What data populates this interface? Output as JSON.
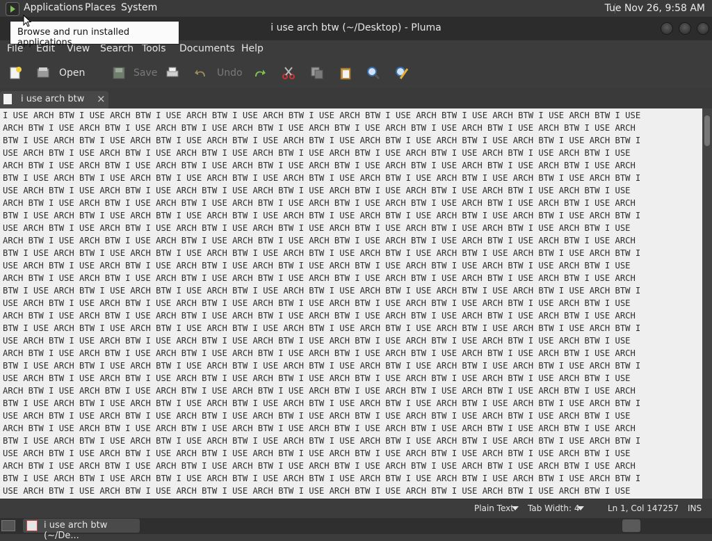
{
  "top_panel": {
    "menus": [
      "Applications",
      "Places",
      "System"
    ],
    "clock": "Tue Nov 26,  9:58 AM"
  },
  "tooltip": "Browse and run installed applications",
  "window": {
    "title": "i use arch btw (~/Desktop) - Pluma"
  },
  "menubar": [
    "File",
    "Edit",
    "View",
    "Search",
    "Tools",
    "Documents",
    "Help"
  ],
  "toolbar": {
    "open": "Open",
    "save": "Save",
    "undo": "Undo"
  },
  "tab": {
    "label": "i use arch btw",
    "close": "×"
  },
  "editor": {
    "lines": [
      "I USE ARCH BTW I USE ARCH BTW I USE ARCH BTW I USE ARCH BTW I USE ARCH BTW I USE ARCH BTW I USE ARCH BTW I USE ARCH BTW I USE",
      "ARCH BTW I USE ARCH BTW I USE ARCH BTW I USE ARCH BTW I USE ARCH BTW I USE ARCH BTW I USE ARCH BTW I USE ARCH BTW I USE ARCH",
      "BTW I USE ARCH BTW I USE ARCH BTW I USE ARCH BTW I USE ARCH BTW I USE ARCH BTW I USE ARCH BTW I USE ARCH BTW I USE ARCH BTW I",
      "USE ARCH BTW I USE ARCH BTW I USE ARCH BTW I USE ARCH BTW I USE ARCH BTW I USE ARCH BTW I USE ARCH BTW I USE ARCH BTW I USE",
      "ARCH BTW I USE ARCH BTW I USE ARCH BTW I USE ARCH BTW I USE ARCH BTW I USE ARCH BTW I USE ARCH BTW I USE ARCH BTW I USE ARCH",
      "BTW I USE ARCH BTW I USE ARCH BTW I USE ARCH BTW I USE ARCH BTW I USE ARCH BTW I USE ARCH BTW I USE ARCH BTW I USE ARCH BTW I",
      "USE ARCH BTW I USE ARCH BTW I USE ARCH BTW I USE ARCH BTW I USE ARCH BTW I USE ARCH BTW I USE ARCH BTW I USE ARCH BTW I USE",
      "ARCH BTW I USE ARCH BTW I USE ARCH BTW I USE ARCH BTW I USE ARCH BTW I USE ARCH BTW I USE ARCH BTW I USE ARCH BTW I USE ARCH",
      "BTW I USE ARCH BTW I USE ARCH BTW I USE ARCH BTW I USE ARCH BTW I USE ARCH BTW I USE ARCH BTW I USE ARCH BTW I USE ARCH BTW I",
      "USE ARCH BTW I USE ARCH BTW I USE ARCH BTW I USE ARCH BTW I USE ARCH BTW I USE ARCH BTW I USE ARCH BTW I USE ARCH BTW I USE",
      "ARCH BTW I USE ARCH BTW I USE ARCH BTW I USE ARCH BTW I USE ARCH BTW I USE ARCH BTW I USE ARCH BTW I USE ARCH BTW I USE ARCH",
      "BTW I USE ARCH BTW I USE ARCH BTW I USE ARCH BTW I USE ARCH BTW I USE ARCH BTW I USE ARCH BTW I USE ARCH BTW I USE ARCH BTW I",
      "USE ARCH BTW I USE ARCH BTW I USE ARCH BTW I USE ARCH BTW I USE ARCH BTW I USE ARCH BTW I USE ARCH BTW I USE ARCH BTW I USE",
      "ARCH BTW I USE ARCH BTW I USE ARCH BTW I USE ARCH BTW I USE ARCH BTW I USE ARCH BTW I USE ARCH BTW I USE ARCH BTW I USE ARCH",
      "BTW I USE ARCH BTW I USE ARCH BTW I USE ARCH BTW I USE ARCH BTW I USE ARCH BTW I USE ARCH BTW I USE ARCH BTW I USE ARCH BTW I",
      "USE ARCH BTW I USE ARCH BTW I USE ARCH BTW I USE ARCH BTW I USE ARCH BTW I USE ARCH BTW I USE ARCH BTW I USE ARCH BTW I USE",
      "ARCH BTW I USE ARCH BTW I USE ARCH BTW I USE ARCH BTW I USE ARCH BTW I USE ARCH BTW I USE ARCH BTW I USE ARCH BTW I USE ARCH",
      "BTW I USE ARCH BTW I USE ARCH BTW I USE ARCH BTW I USE ARCH BTW I USE ARCH BTW I USE ARCH BTW I USE ARCH BTW I USE ARCH BTW I",
      "USE ARCH BTW I USE ARCH BTW I USE ARCH BTW I USE ARCH BTW I USE ARCH BTW I USE ARCH BTW I USE ARCH BTW I USE ARCH BTW I USE",
      "ARCH BTW I USE ARCH BTW I USE ARCH BTW I USE ARCH BTW I USE ARCH BTW I USE ARCH BTW I USE ARCH BTW I USE ARCH BTW I USE ARCH",
      "BTW I USE ARCH BTW I USE ARCH BTW I USE ARCH BTW I USE ARCH BTW I USE ARCH BTW I USE ARCH BTW I USE ARCH BTW I USE ARCH BTW I",
      "USE ARCH BTW I USE ARCH BTW I USE ARCH BTW I USE ARCH BTW I USE ARCH BTW I USE ARCH BTW I USE ARCH BTW I USE ARCH BTW I USE",
      "ARCH BTW I USE ARCH BTW I USE ARCH BTW I USE ARCH BTW I USE ARCH BTW I USE ARCH BTW I USE ARCH BTW I USE ARCH BTW I USE ARCH",
      "BTW I USE ARCH BTW I USE ARCH BTW I USE ARCH BTW I USE ARCH BTW I USE ARCH BTW I USE ARCH BTW I USE ARCH BTW I USE ARCH BTW I",
      "USE ARCH BTW I USE ARCH BTW I USE ARCH BTW I USE ARCH BTW I USE ARCH BTW I USE ARCH BTW I USE ARCH BTW I USE ARCH BTW I USE",
      "ARCH BTW I USE ARCH BTW I USE ARCH BTW I USE ARCH BTW I USE ARCH BTW I USE ARCH BTW I USE ARCH BTW I USE ARCH BTW I USE ARCH",
      "BTW I USE ARCH BTW I USE ARCH BTW I USE ARCH BTW I USE ARCH BTW I USE ARCH BTW I USE ARCH BTW I USE ARCH BTW I USE ARCH BTW I",
      "USE ARCH BTW I USE ARCH BTW I USE ARCH BTW I USE ARCH BTW I USE ARCH BTW I USE ARCH BTW I USE ARCH BTW I USE ARCH BTW I USE",
      "ARCH BTW I USE ARCH BTW I USE ARCH BTW I USE ARCH BTW I USE ARCH BTW I USE ARCH BTW I USE ARCH BTW I USE ARCH BTW I USE ARCH",
      "BTW I USE ARCH BTW I USE ARCH BTW I USE ARCH BTW I USE ARCH BTW I USE ARCH BTW I USE ARCH BTW I USE ARCH BTW I USE ARCH BTW I",
      "USE ARCH BTW I USE ARCH BTW I USE ARCH BTW I USE ARCH BTW I USE ARCH BTW I USE ARCH BTW I USE ARCH BTW I USE ARCH BTW I USE"
    ]
  },
  "statusbar": {
    "language": "Plain Text",
    "tab_width": "Tab Width:  4",
    "position": "Ln 1, Col 147257",
    "mode": "INS"
  },
  "taskbar": {
    "item": "i use arch btw (~/De..."
  },
  "colors": {
    "panel": "#3a3a3a",
    "editor_bg": "#efefef",
    "accent_green": "#7ec34f"
  }
}
